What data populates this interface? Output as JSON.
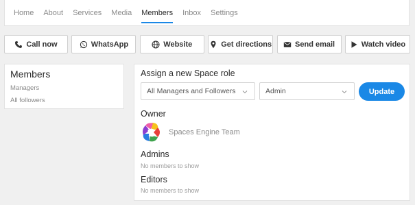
{
  "tabs": [
    {
      "label": "Home"
    },
    {
      "label": "About"
    },
    {
      "label": "Services"
    },
    {
      "label": "Media"
    },
    {
      "label": "Members",
      "active": true
    },
    {
      "label": "Inbox"
    },
    {
      "label": "Settings"
    }
  ],
  "actions": [
    {
      "label": "Call now",
      "icon": "phone-icon"
    },
    {
      "label": "WhatsApp",
      "icon": "whatsapp-icon"
    },
    {
      "label": "Website",
      "icon": "globe-icon"
    },
    {
      "label": "Get directions",
      "icon": "map-pin-icon"
    },
    {
      "label": "Send email",
      "icon": "envelope-icon"
    },
    {
      "label": "Watch video",
      "icon": "play-icon"
    }
  ],
  "sidebar": {
    "title": "Members",
    "links": [
      {
        "label": "Managers"
      },
      {
        "label": "All followers"
      }
    ]
  },
  "main": {
    "assign_title": "Assign a new Space role",
    "audience_select": {
      "value": "All Managers and Followers"
    },
    "role_select": {
      "value": "Admin"
    },
    "update_label": "Update",
    "owner_title": "Owner",
    "owner_name": "Spaces Engine Team",
    "admins_title": "Admins",
    "admins_empty": "No members to show",
    "editors_title": "Editors",
    "editors_empty": "No members to show"
  },
  "colors": {
    "accent": "#1a88e6",
    "background": "#f0f0f0"
  }
}
